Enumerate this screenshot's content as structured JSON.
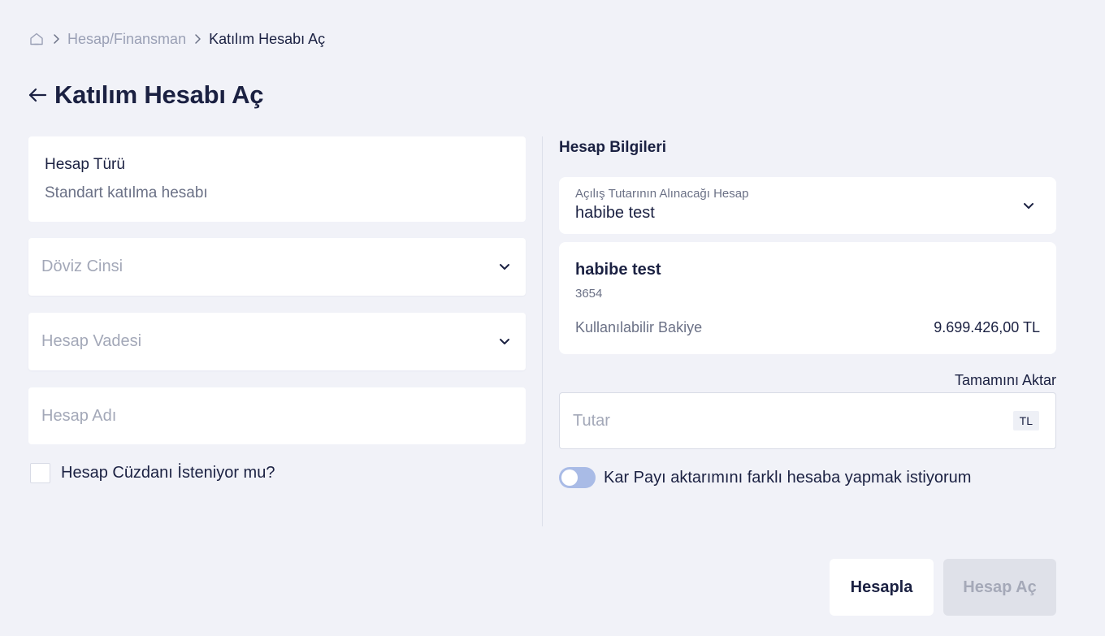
{
  "breadcrumb": {
    "items": [
      {
        "label": "Hesap/Finansman"
      },
      {
        "label": "Katılım Hesabı Aç"
      }
    ]
  },
  "page": {
    "title": "Katılım Hesabı Aç"
  },
  "form": {
    "account_type": {
      "label": "Hesap Türü",
      "value": "Standart katılma hesabı"
    },
    "currency_select": {
      "placeholder": "Döviz Cinsi"
    },
    "term_select": {
      "placeholder": "Hesap Vadesi"
    },
    "account_name": {
      "placeholder": "Hesap Adı",
      "value": ""
    },
    "wallet_checkbox": {
      "label": "Hesap Cüzdanı İsteniyor mu?",
      "checked": false
    }
  },
  "account_info": {
    "section_title": "Hesap Bilgileri",
    "source_select": {
      "label": "Açılış Tutarının Alınacağı Hesap",
      "value": "habibe test"
    },
    "details": {
      "name": "habibe test",
      "number": "3654",
      "balance_label": "Kullanılabilir Bakiye",
      "balance_value": "9.699.426,00 TL"
    },
    "transfer_all_label": "Tamamını Aktar",
    "amount": {
      "placeholder": "Tutar",
      "currency": "TL",
      "value": ""
    },
    "profit_share_toggle": {
      "label": "Kar Payı aktarımını farklı hesaba yapmak istiyorum",
      "on": false
    }
  },
  "actions": {
    "calculate_label": "Hesapla",
    "open_label": "Hesap Aç"
  },
  "colors": {
    "background": "#f1f2f8",
    "text_primary": "#1b2142",
    "text_secondary": "#6b7186",
    "toggle_off": "#a9bbe6",
    "button_disabled": "#dfe1e9"
  },
  "icons": {
    "home": "home-icon",
    "separator": "chevron-right-icon",
    "back": "arrow-left-icon",
    "dropdown": "chevron-down-icon"
  }
}
